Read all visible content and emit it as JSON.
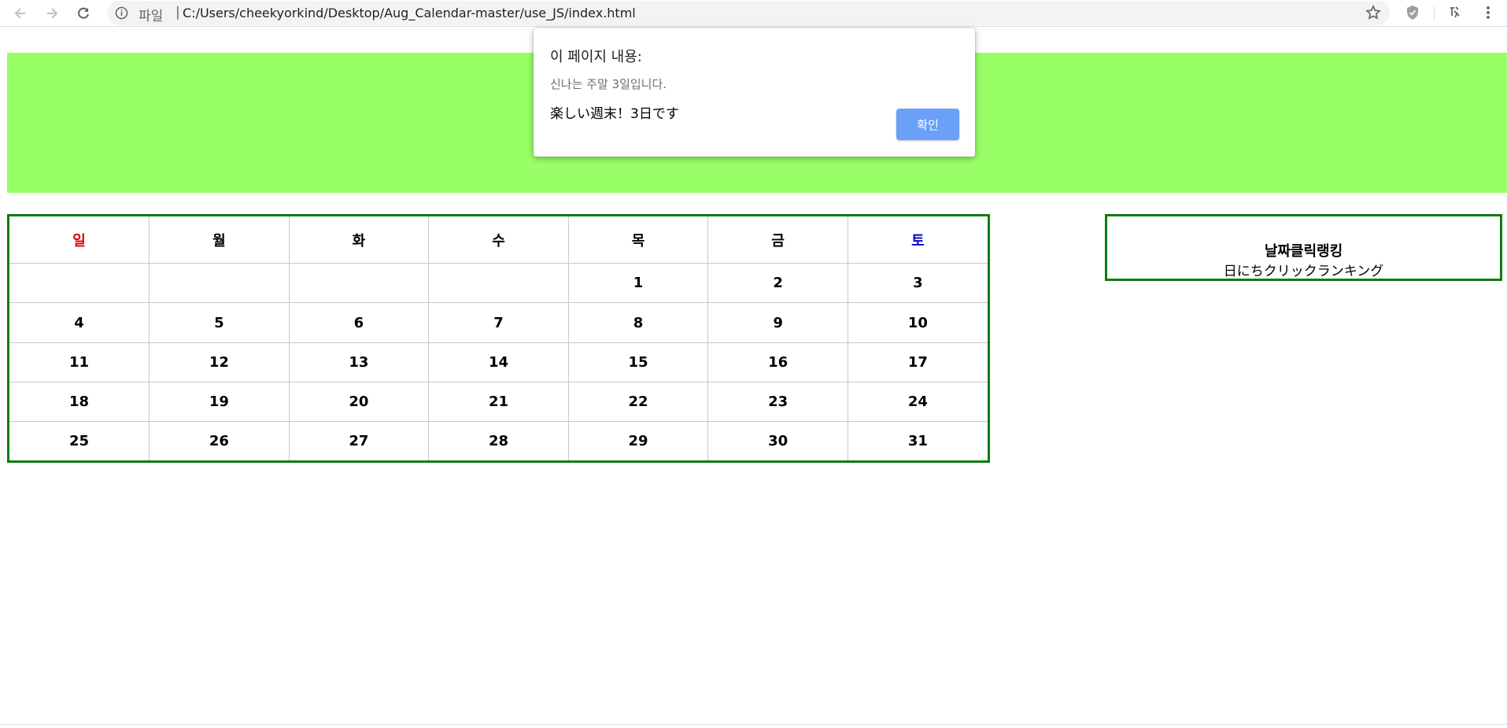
{
  "browser": {
    "scheme_label": "파일",
    "separator": "|",
    "url": "C:/Users/cheekyorkind/Desktop/Aug_Calendar-master/use_JS/index.html",
    "icons": [
      "back-icon",
      "forward-icon",
      "reload-icon",
      "info-icon",
      "star-icon",
      "shield-extension-icon",
      "extension-icon",
      "menu-icon"
    ]
  },
  "page": {
    "banner_color": "#99ff66",
    "border_color": "#0c7d10"
  },
  "calendar": {
    "weekdays": [
      "일",
      "월",
      "화",
      "수",
      "목",
      "금",
      "토"
    ],
    "weekday_colors": {
      "sunday": "#e00000",
      "saturday": "#0000cc"
    },
    "weeks": [
      [
        "",
        "",
        "",
        "",
        "1",
        "2",
        "3"
      ],
      [
        "4",
        "5",
        "6",
        "7",
        "8",
        "9",
        "10"
      ],
      [
        "11",
        "12",
        "13",
        "14",
        "15",
        "16",
        "17"
      ],
      [
        "18",
        "19",
        "20",
        "21",
        "22",
        "23",
        "24"
      ],
      [
        "25",
        "26",
        "27",
        "28",
        "29",
        "30",
        "31"
      ]
    ]
  },
  "ranking": {
    "title": "날짜클릭랭킹",
    "subtitle": "日にちクリックランキング"
  },
  "dialog": {
    "title": "이 페이지 내용:",
    "message": "신나는 주말 3일입니다.",
    "message_jp": "楽しい週末！3日です",
    "ok_label": "확인",
    "ok_color": "#6aa0f8"
  }
}
